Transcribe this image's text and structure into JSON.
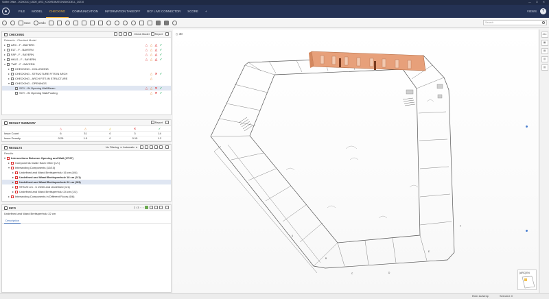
{
  "window": {
    "title": "Solibri Office - 20200310_LBDE_ARC_KOORDINATIONSMODELL_20210"
  },
  "menu": {
    "items": [
      {
        "label": "FILE",
        "active": false
      },
      {
        "label": "MODEL",
        "active": false
      },
      {
        "label": "CHECKING",
        "active": true
      },
      {
        "label": "COMMUNICATION",
        "active": false
      },
      {
        "label": "INFORMATION TAKEOFF",
        "active": false
      },
      {
        "label": "BCF LIVE CONNECTOR",
        "active": false
      },
      {
        "label": "SCORE",
        "active": false
      },
      {
        "label": "+",
        "active": false
      }
    ],
    "views_label": "VIEWS",
    "help_label": "?"
  },
  "toolbar": {
    "save_label": "Save",
    "undo_label": "Undo",
    "search_placeholder": "Search"
  },
  "checking": {
    "title": "CHECKING",
    "check_model_label": "Check Model",
    "report_label": "Report",
    "ruleset_label": "Rulesets - Checked Model",
    "items": [
      {
        "label": "ARC - F - BAYERN",
        "level": 0,
        "expander": "▸",
        "status": [
          "△",
          "△",
          "△",
          "✓"
        ],
        "selected": false
      },
      {
        "label": "ELT - F - BAYERN",
        "level": 0,
        "expander": "▸",
        "status": [
          "△",
          "△",
          "△",
          "✓"
        ],
        "selected": false
      },
      {
        "label": "FAP - F - BAYERN",
        "level": 0,
        "expander": "▸",
        "status": [
          "△",
          "△",
          "△",
          "✓"
        ],
        "selected": false
      },
      {
        "label": "HKLS - F - BAYERN",
        "level": 0,
        "expander": "▸",
        "status": [
          "△",
          "△",
          "△",
          "✓"
        ],
        "selected": false
      },
      {
        "label": "TWP - F - BAYERN",
        "level": 0,
        "expander": "▾",
        "status": [
          "",
          "",
          "",
          ""
        ],
        "selected": false
      },
      {
        "label": "CHECKING - COLLISIONS",
        "level": 1,
        "expander": "▸",
        "status": [
          "",
          "",
          "",
          ""
        ],
        "selected": false
      },
      {
        "label": "CHECKING - STRUCTURE FITS IN ARCH",
        "level": 1,
        "expander": "▸",
        "status": [
          "",
          "△",
          "✕",
          "✓"
        ],
        "selected": false
      },
      {
        "label": "CHECKING - ARCH FITS IN STRUCTURE",
        "level": 1,
        "expander": "▸",
        "status": [
          "",
          "△",
          "",
          ""
        ],
        "selected": false
      },
      {
        "label": "CHECKING - OPENINGS",
        "level": 1,
        "expander": "▾",
        "status": [
          "",
          "",
          "",
          ""
        ],
        "selected": false
      },
      {
        "label": "SOY - IN Opening Wall/Beam",
        "level": 2,
        "expander": "",
        "status": [
          "△",
          "△",
          "✕",
          "✓"
        ],
        "selected": true
      },
      {
        "label": "SOY - IN Opening Slab/Footing",
        "level": 2,
        "expander": "",
        "status": [
          "",
          "△",
          "✕",
          "✓"
        ],
        "selected": false
      }
    ]
  },
  "result_summary": {
    "title": "RESULT SUMMARY",
    "report_label": "Report",
    "header_icons": [
      "△",
      "△",
      "△",
      "✕",
      "✓"
    ],
    "rows": [
      {
        "label": "Issue Count",
        "values": [
          "6",
          "31",
          "0",
          "3",
          "14"
        ]
      },
      {
        "label": "Issue Density",
        "values": [
          "0.29",
          "1.0",
          "0",
          "0.15",
          "1.2"
        ]
      }
    ]
  },
  "results": {
    "title": "RESULTS",
    "filter_label": "No Filtering",
    "mode_label": "Automatic",
    "column_label": "Results",
    "items": [
      {
        "label": "Intersections Between Opening and Wall (27/27)",
        "level": 0,
        "expander": "▾",
        "selected": false,
        "bold": true
      },
      {
        "label": "Components Inside Each Other (1/1)",
        "level": 1,
        "expander": "▸",
        "selected": false,
        "bold": false
      },
      {
        "label": "Intersecting Components (10/10)",
        "level": 1,
        "expander": "▾",
        "selected": false,
        "bold": false
      },
      {
        "label": "Undefined and Wand Breitsperrholz 16 cm (4/4)",
        "level": 2,
        "expander": "▸",
        "selected": false,
        "bold": false
      },
      {
        "label": "Undefined and Wand Breitsperrholz 18 cm (1/1)",
        "level": 2,
        "expander": "▸",
        "selected": false,
        "bold": true
      },
      {
        "label": "Undefined and Wand Breitsperrholz 22 cm (3/3)",
        "level": 2,
        "expander": "▸",
        "selected": true,
        "bold": true
      },
      {
        "label": "STB 20 cm - C 20/30 and Undefined (1/1)",
        "level": 2,
        "expander": "▸",
        "selected": false,
        "bold": false
      },
      {
        "label": "Undefined and Wand Breitsperrholz 24 cm (1/1)",
        "level": 2,
        "expander": "▸",
        "selected": false,
        "bold": false
      },
      {
        "label": "Intersecting Components in Different Floors (6/6)",
        "level": 1,
        "expander": "▸",
        "selected": false,
        "bold": false
      }
    ]
  },
  "info": {
    "title": "INFO",
    "counter": "2 / 3",
    "selected_item": "Undefined and Wand Breitsperrholz 22 cm",
    "tab_label": "Description"
  },
  "viewport": {
    "label": "3D"
  },
  "rightbar": {
    "buttons": [
      "Abc",
      "▦",
      "▤",
      "▥",
      "▧"
    ]
  },
  "minimap": {
    "label": "[ARC] EN"
  },
  "status": {
    "left": "Elder Aufstrdp",
    "right": "Selected: 0"
  }
}
